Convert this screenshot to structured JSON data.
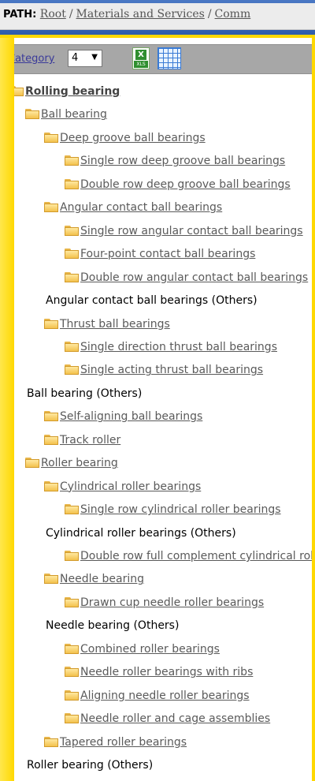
{
  "path": {
    "label": "PATH:",
    "crumbs": [
      "Root",
      "Materials and Services",
      "Comm"
    ]
  },
  "toolbar": {
    "category_label": "Category",
    "category_value": "4",
    "xls_icon_text": "XLS"
  },
  "tree": [
    {
      "text": "Rolling bearing",
      "level": 0,
      "folder": true,
      "bold": true
    },
    {
      "text": "Ball bearing",
      "level": 1,
      "folder": true
    },
    {
      "text": "Deep groove ball bearings",
      "level": 2,
      "folder": true
    },
    {
      "text": "Single row deep groove ball bearings",
      "level": 3,
      "folder": true
    },
    {
      "text": "Double row deep groove ball bearings",
      "level": 3,
      "folder": true
    },
    {
      "text": "Angular contact ball bearings",
      "level": 2,
      "folder": true
    },
    {
      "text": "Single row angular contact ball bearings",
      "level": 3,
      "folder": true
    },
    {
      "text": "Four-point contact ball bearings",
      "level": 3,
      "folder": true
    },
    {
      "text": "Double row angular contact ball bearings",
      "level": 3,
      "folder": true
    },
    {
      "text": "Angular contact ball bearings (Others)",
      "level": 2,
      "folder": false
    },
    {
      "text": "Thrust ball bearings",
      "level": 2,
      "folder": true
    },
    {
      "text": "Single direction thrust ball bearings",
      "level": 3,
      "folder": true
    },
    {
      "text": "Single acting thrust ball bearings",
      "level": 3,
      "folder": true
    },
    {
      "text": "Ball bearing (Others)",
      "level": 1,
      "folder": false
    },
    {
      "text": "Self-aligning ball bearings",
      "level": 2,
      "folder": true
    },
    {
      "text": "Track roller",
      "level": 2,
      "folder": true
    },
    {
      "text": "Roller bearing",
      "level": 1,
      "folder": true
    },
    {
      "text": "Cylindrical roller bearings",
      "level": 2,
      "folder": true
    },
    {
      "text": "Single row cylindrical roller bearings",
      "level": 3,
      "folder": true
    },
    {
      "text": "Cylindrical roller bearings (Others)",
      "level": 2,
      "folder": false
    },
    {
      "text": "Double row full complement cylindrical roller bearings",
      "level": 3,
      "folder": true
    },
    {
      "text": "Needle bearing",
      "level": 2,
      "folder": true
    },
    {
      "text": "Drawn cup needle roller bearings",
      "level": 3,
      "folder": true
    },
    {
      "text": "Needle bearing (Others)",
      "level": 2,
      "folder": false
    },
    {
      "text": "Combined roller bearings",
      "level": 3,
      "folder": true
    },
    {
      "text": "Needle roller bearings with ribs",
      "level": 3,
      "folder": true
    },
    {
      "text": "Aligning needle roller bearings",
      "level": 3,
      "folder": true
    },
    {
      "text": "Needle roller and cage assemblies",
      "level": 3,
      "folder": true
    },
    {
      "text": "Tapered roller bearings",
      "level": 2,
      "folder": true
    },
    {
      "text": "Roller bearing (Others)",
      "level": 1,
      "folder": false
    }
  ]
}
